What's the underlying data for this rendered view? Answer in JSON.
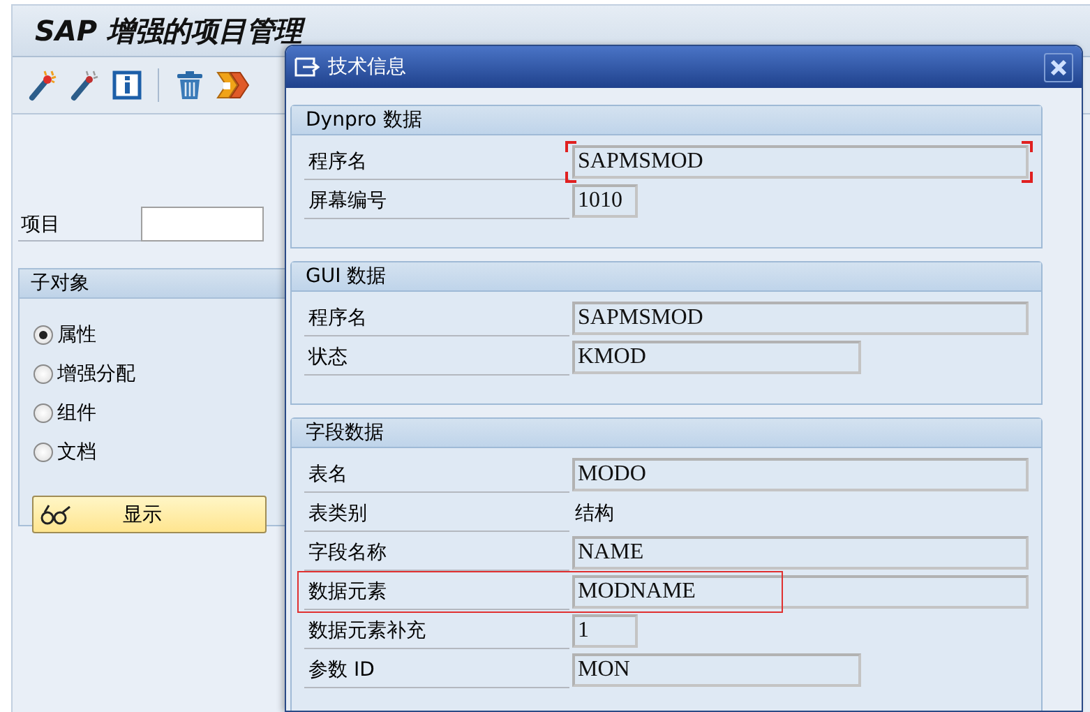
{
  "window": {
    "title": "SAP 增强的项目管理"
  },
  "project": {
    "label": "项目"
  },
  "subobjects": {
    "title": "子对象",
    "options": [
      {
        "label": "属性",
        "selected": true
      },
      {
        "label": "增强分配",
        "selected": false
      },
      {
        "label": "组件",
        "selected": false
      },
      {
        "label": "文档",
        "selected": false
      }
    ],
    "button": "显示"
  },
  "dialog": {
    "title": "技术信息",
    "sections": [
      {
        "title": "Dynpro 数据",
        "rows": [
          {
            "label": "程序名",
            "value": "SAPMSMOD",
            "kind": "long",
            "focused": true,
            "highlighted": false
          },
          {
            "label": "屏幕编号",
            "value": "1010",
            "kind": "short",
            "focused": false,
            "highlighted": false
          }
        ]
      },
      {
        "title": "GUI 数据",
        "rows": [
          {
            "label": "程序名",
            "value": "SAPMSMOD",
            "kind": "long",
            "focused": false,
            "highlighted": false
          },
          {
            "label": "状态",
            "value": "KMOD",
            "kind": "medium",
            "focused": false,
            "highlighted": false
          }
        ]
      },
      {
        "title": "字段数据",
        "rows": [
          {
            "label": "表名",
            "value": "MODO",
            "kind": "long",
            "focused": false,
            "highlighted": false
          },
          {
            "label": "表类别",
            "value": "结构",
            "kind": "text",
            "highlighted": false
          },
          {
            "label": "字段名称",
            "value": "NAME",
            "kind": "long",
            "focused": false,
            "highlighted": false
          },
          {
            "label": "数据元素",
            "value": "MODNAME",
            "kind": "long",
            "focused": false,
            "highlighted": true
          },
          {
            "label": "数据元素补充",
            "value": "1",
            "kind": "short",
            "focused": false,
            "highlighted": false
          },
          {
            "label": "参数 ID",
            "value": "MON",
            "kind": "medium",
            "focused": false,
            "highlighted": false
          }
        ]
      }
    ]
  }
}
